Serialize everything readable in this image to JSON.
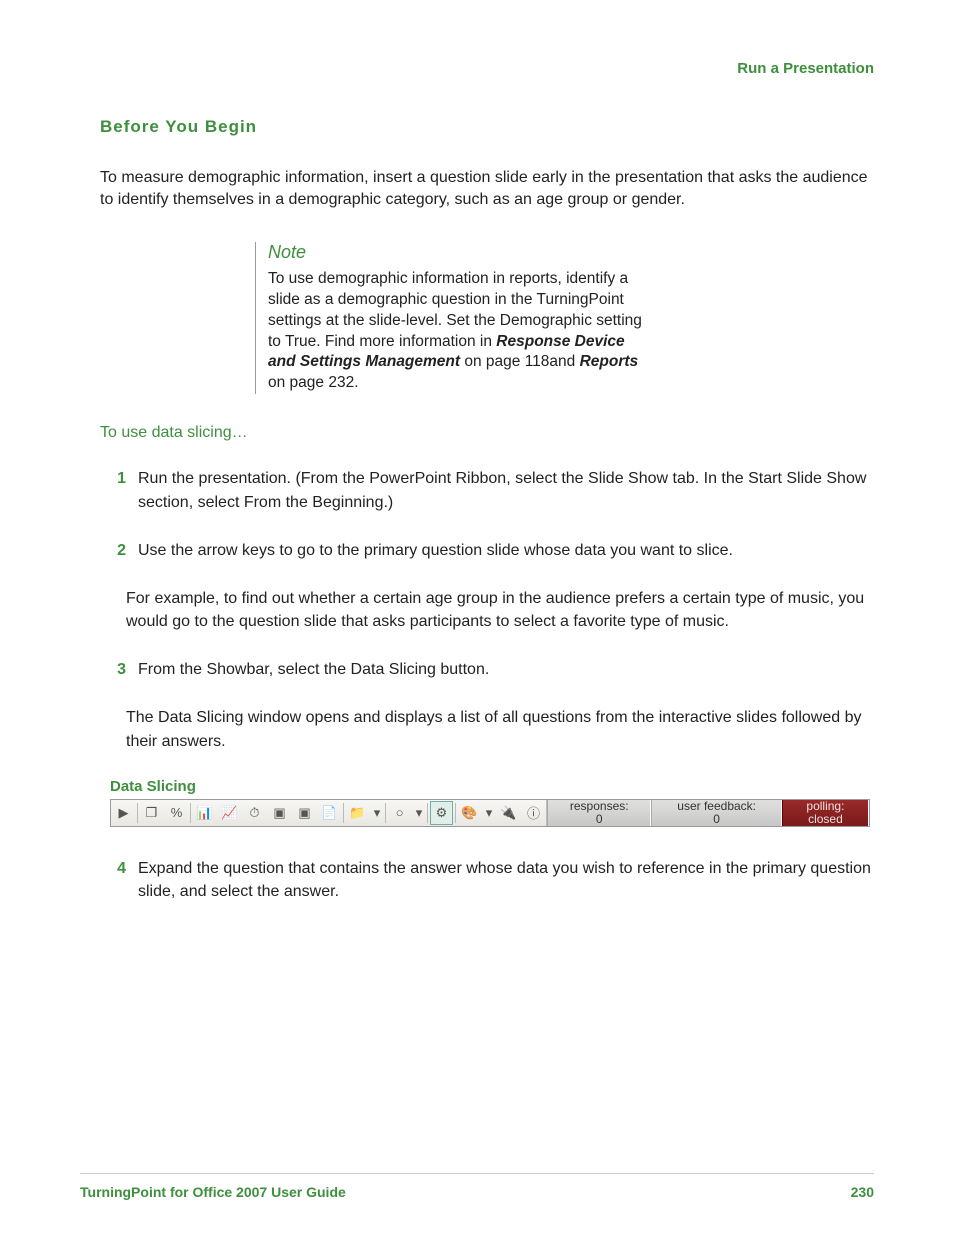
{
  "header": {
    "section": "Run a Presentation"
  },
  "heading": "Before You Begin",
  "intro": "To measure demographic information, insert a question slide early in the presentation that asks the audience to identify themselves in a demographic category, such as an age group or gender.",
  "note": {
    "title": "Note",
    "pre": "To use demographic information in reports, identify a slide as a demographic question in the TurningPoint settings at the slide-level. Set the Demographic setting to True. Find more information in ",
    "bold1": "Response Device and Settings Management",
    "mid1": " on page 118and ",
    "bold2": "Reports",
    "post": " on page 232."
  },
  "subhead": "To use data slicing…",
  "steps": {
    "s1": {
      "n": "1",
      "t": "Run the presentation. (From the PowerPoint Ribbon, select the Slide Show tab. In the Start Slide Show section, select From the Beginning.)"
    },
    "s2": {
      "n": "2",
      "t": "Use the arrow keys to go to the primary question slide whose data you want to slice."
    },
    "s2b": "For example, to find out whether a certain age group in the audience prefers a certain type of music, you would go to the question slide that asks participants to select a favorite type of music.",
    "s3": {
      "n": "3",
      "t": "From the Showbar, select the Data Slicing button."
    },
    "s3b": "The Data Slicing window opens and displays a list of all questions from the interactive slides followed by their answers.",
    "s4": {
      "n": "4",
      "t": "Expand the question that contains the answer whose data you wish to reference in the primary question slide, and select the answer."
    }
  },
  "figure": {
    "caption": "Data Slicing",
    "icons": {
      "i1": "▶",
      "i2": "❐",
      "i3": "%",
      "i4": "📊",
      "i5": "📈",
      "i6": "⏱",
      "i7": "▣",
      "i8": "▣",
      "i9": "📄",
      "i10": "📁",
      "i11": "▾",
      "i12": "○",
      "i13": "▾",
      "i14": "⚙",
      "i15": "🎨",
      "i16": "▾",
      "i17": "🔌",
      "i18": "ⓘ"
    },
    "status": {
      "responses_label": "responses:",
      "responses_value": "0",
      "feedback_label": "user feedback:",
      "feedback_value": "0",
      "polling_label": "polling:",
      "polling_value": "closed"
    }
  },
  "footer": {
    "title": "TurningPoint for Office 2007 User Guide",
    "page": "230"
  }
}
